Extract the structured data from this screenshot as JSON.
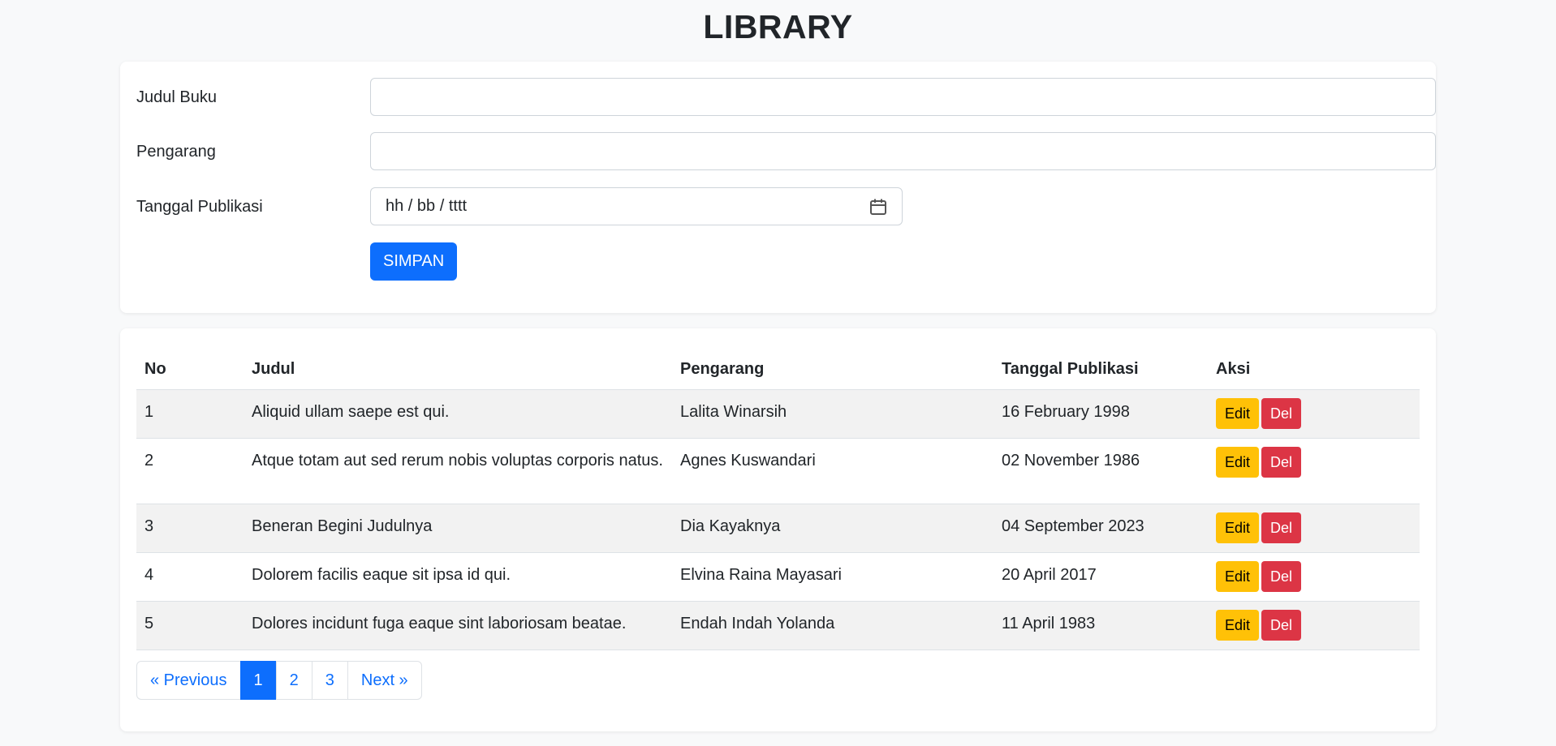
{
  "title": "LIBRARY",
  "form": {
    "title_label": "Judul Buku",
    "title_value": "",
    "author_label": "Pengarang",
    "author_value": "",
    "date_label": "Tanggal Publikasi",
    "date_placeholder": "hh / bb / tttt",
    "date_icon": "calendar-icon",
    "submit_label": "SIMPAN"
  },
  "table": {
    "headers": [
      "No",
      "Judul",
      "Pengarang",
      "Tanggal Publikasi",
      "Aksi"
    ],
    "rows": [
      {
        "no": "1",
        "judul": "Aliquid ullam saepe est qui.",
        "pengarang": "Lalita Winarsih",
        "tanggal": "16 February 1998",
        "edit": "Edit",
        "del": "Del"
      },
      {
        "no": "2",
        "judul": "Atque totam aut sed rerum nobis voluptas corporis natus.",
        "pengarang": "Agnes Kuswandari",
        "tanggal": "02 November 1986",
        "edit": "Edit",
        "del": "Del"
      },
      {
        "no": "3",
        "judul": "Beneran Begini Judulnya",
        "pengarang": "Dia Kayaknya",
        "tanggal": "04 September 2023",
        "edit": "Edit",
        "del": "Del"
      },
      {
        "no": "4",
        "judul": "Dolorem facilis eaque sit ipsa id qui.",
        "pengarang": "Elvina Raina Mayasari",
        "tanggal": "20 April 2017",
        "edit": "Edit",
        "del": "Del"
      },
      {
        "no": "5",
        "judul": "Dolores incidunt fuga eaque sint laboriosam beatae.",
        "pengarang": "Endah Indah Yolanda",
        "tanggal": "11 April 1983",
        "edit": "Edit",
        "del": "Del"
      }
    ]
  },
  "pagination": {
    "previous": "« Previous",
    "pages": [
      "1",
      "2",
      "3"
    ],
    "active_page": "1",
    "next": "Next »"
  },
  "colors": {
    "primary": "#0d6efd",
    "warning": "#ffc107",
    "danger": "#dc3545"
  }
}
